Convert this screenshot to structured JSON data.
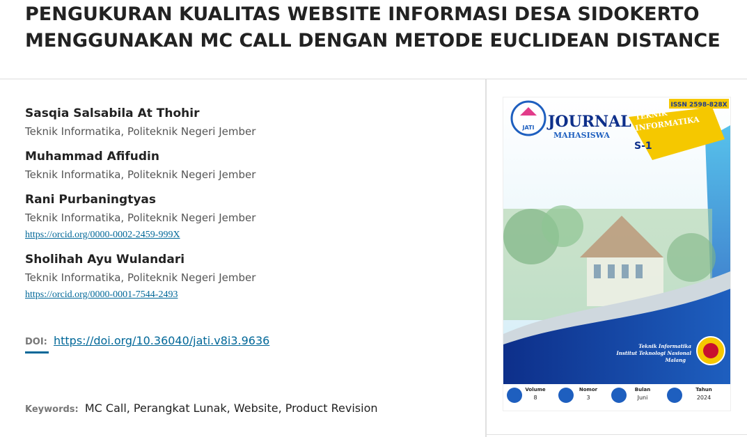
{
  "article": {
    "title": "PENGUKURAN KUALITAS WEBSITE INFORMASI DESA SIDOKERTO MENGGUNAKAN MC CALL DENGAN METODE EUCLIDEAN DISTANCE",
    "authors": [
      {
        "name": "Sasqia Salsabila At Thohir",
        "affiliation": "Teknik Informatika, Politeknik Negeri Jember",
        "orcid": ""
      },
      {
        "name": "Muhammad Afifudin",
        "affiliation": "Teknik Informatika, Politeknik Negeri Jember",
        "orcid": ""
      },
      {
        "name": "Rani Purbaningtyas",
        "affiliation": "Teknik Informatika, Politeknik Negeri Jember",
        "orcid": "https://orcid.org/0000-0002-2459-999X"
      },
      {
        "name": "Sholihah Ayu Wulandari",
        "affiliation": "Teknik Informatika, Politeknik Negeri Jember",
        "orcid": "https://orcid.org/0000-0001-7544-2493"
      }
    ],
    "doi_label": "DOI:",
    "doi": "https://doi.org/10.36040/jati.v8i3.9636",
    "keywords_label": "Keywords:",
    "keywords": "MC Call, Perangkat Lunak, Website, Product Revision"
  },
  "cover": {
    "issn": "ISSN 2598-828X",
    "logo_text": "JATI",
    "journal": "JOURNAL",
    "mahasiswa": "MAHASISWA",
    "program": "TEKNIK INFORMATIKA",
    "program_line1": "TEKNIK",
    "program_line2": "INFORMATIKA",
    "level": "S-1",
    "institution_line1": "Teknik Informatika",
    "institution_line2": "Institut Teknologi Nasional",
    "institution_line3": "Malang",
    "info": [
      {
        "label": "Volume",
        "value": "8"
      },
      {
        "label": "Nomor",
        "value": "3"
      },
      {
        "label": "Bulan",
        "value": "Juni"
      },
      {
        "label": "Tahun",
        "value": "2024"
      }
    ],
    "colors": {
      "blue": "#1e5fbf",
      "yellow": "#f5c800",
      "dark_blue": "#0d2f8a",
      "cyan": "#3ab7e8"
    }
  }
}
